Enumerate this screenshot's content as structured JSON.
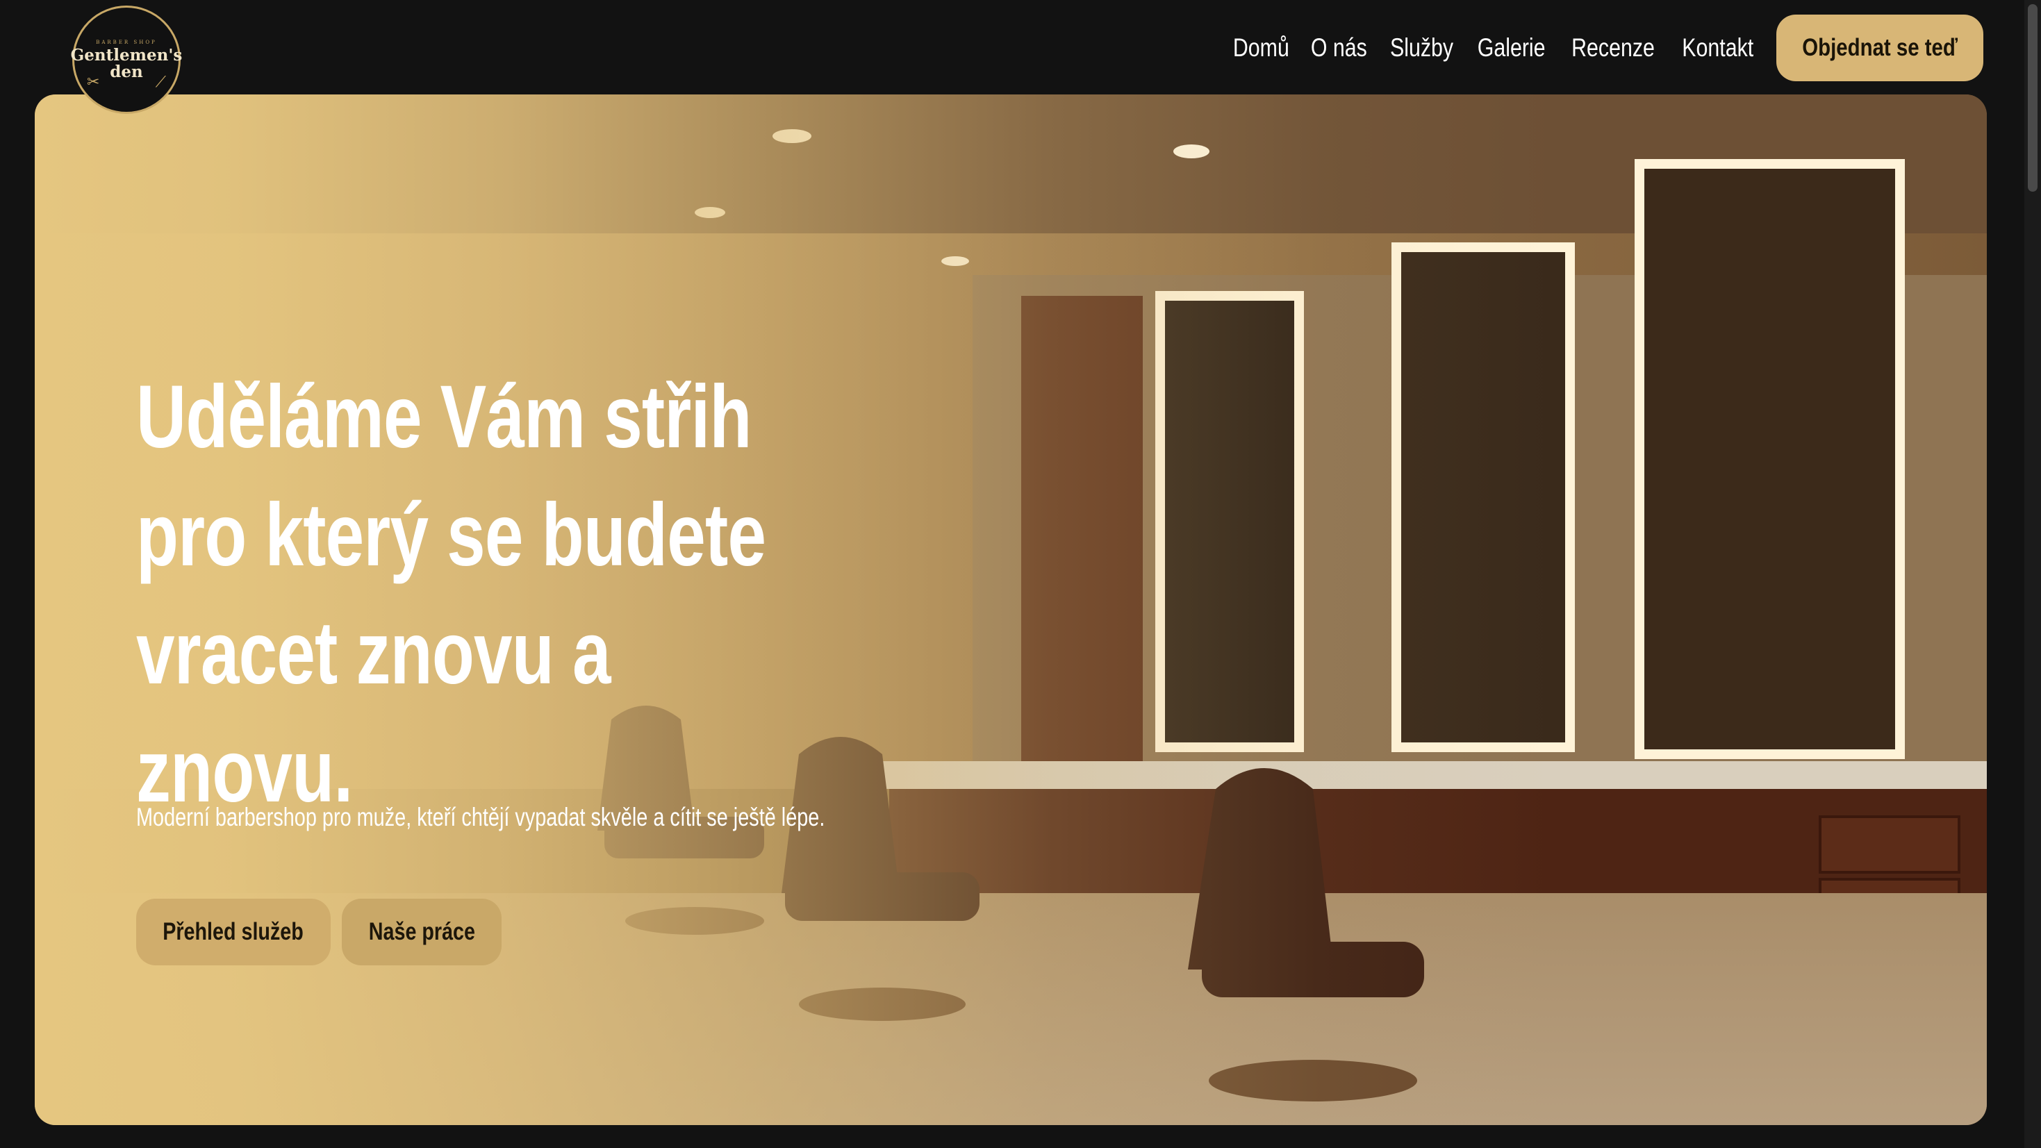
{
  "brand": {
    "logo_tagline": "BARBER SHOP",
    "logo_line1": "Gentlemen's",
    "logo_line2": "den"
  },
  "nav": {
    "items": [
      "Domů",
      "O nás",
      "Služby",
      "Galerie",
      "Recenze",
      "Kontakt"
    ],
    "cta_label": "Objednat se teď"
  },
  "hero": {
    "title": "Uděláme Vám střih pro který se budete vracet znovu a znovu.",
    "subtitle": "Moderní barbershop pro muže, kteří chtějí vypadat skvěle a cítit se ještě lépe.",
    "buttons": [
      "Přehled služeb",
      "Naše práce"
    ]
  },
  "colors": {
    "background": "#121212",
    "accent": "#d8b676",
    "button_text": "#1a1408",
    "overlay": "#e5c680"
  },
  "icons": {
    "logo_left": "scissors-icon",
    "logo_right": "razor-icon"
  }
}
